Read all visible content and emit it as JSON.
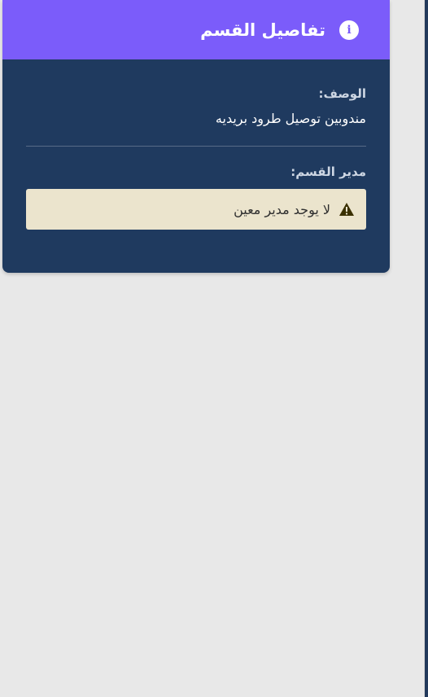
{
  "card": {
    "title": "تفاصيل القسم",
    "header_icon": "info-icon",
    "header_color": "#7b5cfa",
    "body_color": "#1f3a5f"
  },
  "description": {
    "label": "الوصف:",
    "value": "مندوبين توصيل طرود بريديه"
  },
  "manager": {
    "label": "مدير القسم:",
    "alert_icon": "warning-icon",
    "alert_text": "لا يوجد مدير معين",
    "alert_color": "#ebe4cd"
  }
}
